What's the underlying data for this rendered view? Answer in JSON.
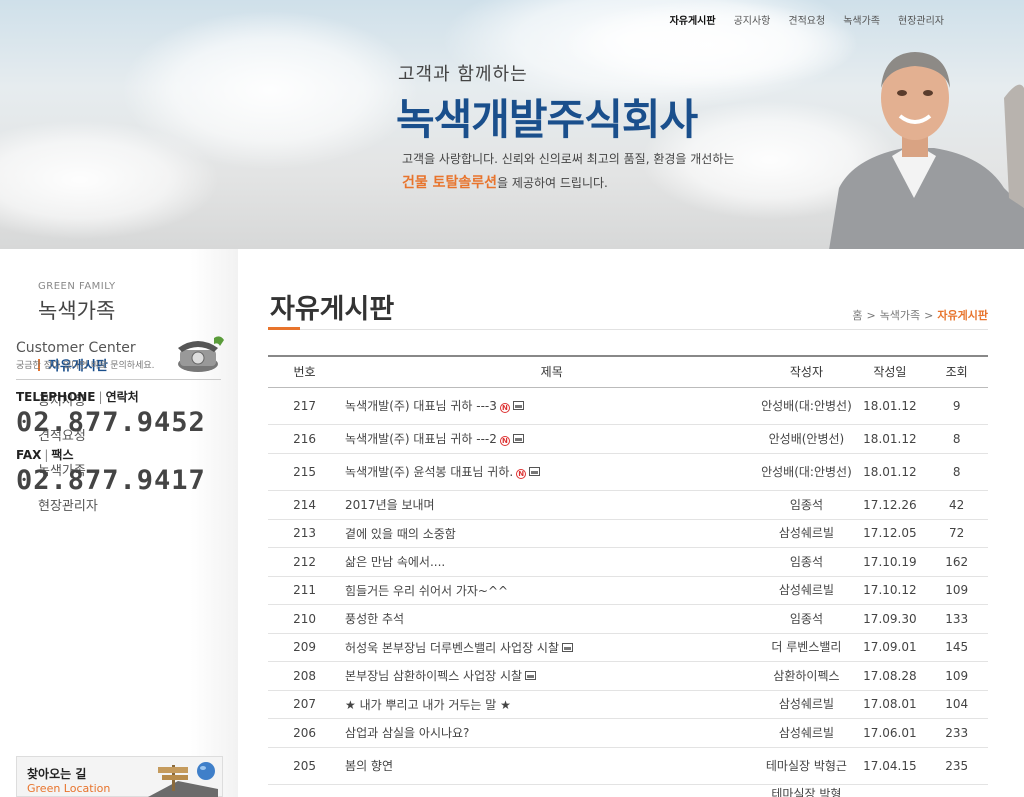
{
  "topnav": [
    "자유게시판",
    "공지사항",
    "견적요청",
    "녹색가족",
    "현장관리자"
  ],
  "hero": {
    "subtitle": "고객과 함께하는",
    "title": "녹색개발주식회사",
    "desc1": "고객을 사랑합니다. 신뢰와 신의로써 최고의 품질, 환경을 개선하는",
    "desc2_highlight": "건물 토탈솔루션",
    "desc2_rest": "을 제공하여 드립니다."
  },
  "sidebar": {
    "eng_title": "GREEN FAMILY",
    "title": "녹색가족",
    "menu": [
      "자유게시판",
      "공지사항",
      "견적요청",
      "녹색가족",
      "현장관리자"
    ],
    "customer_center": {
      "title": "Customer Center",
      "sub": "궁금한 점이 있다면 바로 문의하세요.",
      "tel_label": "TELEPHONE",
      "tel_label_kr": "연락처",
      "tel": "02.877.9452",
      "fax_label": "FAX",
      "fax_label_kr": "팩스",
      "fax": "02.877.9417"
    },
    "map": {
      "title": "찾아오는 길",
      "sub": "Green Location"
    }
  },
  "main": {
    "page_title": "자유게시판",
    "breadcrumb": [
      "홈",
      "녹색가족",
      "자유게시판"
    ],
    "columns": [
      "번호",
      "제목",
      "작성자",
      "작성일",
      "조회"
    ],
    "rows": [
      {
        "no": "217",
        "title": "녹색개발(주) 대표님 귀하 ---3",
        "new": true,
        "img": true,
        "writer": "안성배(대:안병선)",
        "date": "18.01.12",
        "views": "9"
      },
      {
        "no": "216",
        "title": "녹색개발(주) 대표님 귀하 ---2",
        "new": true,
        "img": true,
        "writer": "안성배(안병선)",
        "date": "18.01.12",
        "views": "8"
      },
      {
        "no": "215",
        "title": "녹색개발(주) 윤석봉 대표님 귀하.",
        "new": true,
        "img": true,
        "writer": "안성배(대:안병선)",
        "date": "18.01.12",
        "views": "8"
      },
      {
        "no": "214",
        "title": "2017년을 보내며",
        "new": false,
        "img": false,
        "writer": "임종석",
        "date": "17.12.26",
        "views": "42"
      },
      {
        "no": "213",
        "title": "곁에 있을 때의 소중함",
        "new": false,
        "img": false,
        "writer": "삼성쉐르빌",
        "date": "17.12.05",
        "views": "72"
      },
      {
        "no": "212",
        "title": "삶은 만남 속에서....",
        "new": false,
        "img": false,
        "writer": "임종석",
        "date": "17.10.19",
        "views": "162"
      },
      {
        "no": "211",
        "title": "힘들거든 우리 쉬어서 가자~^^",
        "new": false,
        "img": false,
        "writer": "삼성쉐르빌",
        "date": "17.10.12",
        "views": "109"
      },
      {
        "no": "210",
        "title": "풍성한 추석",
        "new": false,
        "img": false,
        "writer": "임종석",
        "date": "17.09.30",
        "views": "133"
      },
      {
        "no": "209",
        "title": "허성욱 본부장님 더루벤스밸리 사업장 시찰",
        "new": false,
        "img": true,
        "writer": "더 루벤스밸리",
        "date": "17.09.01",
        "views": "145"
      },
      {
        "no": "208",
        "title": "본부장님 삼환하이펙스 사업장 시찰",
        "new": false,
        "img": true,
        "writer": "삼환하이펙스",
        "date": "17.08.28",
        "views": "109"
      },
      {
        "no": "207",
        "title": "★ 내가 뿌리고 내가 거두는 말 ★",
        "new": false,
        "img": false,
        "writer": "삼성쉐르빌",
        "date": "17.08.01",
        "views": "104"
      },
      {
        "no": "206",
        "title": "삼업과 삼실을 아시나요?",
        "new": false,
        "img": false,
        "writer": "삼성쉐르빌",
        "date": "17.06.01",
        "views": "233"
      },
      {
        "no": "205",
        "title": "봄의 향연",
        "new": false,
        "img": false,
        "writer": "테마실장 박형근",
        "date": "17.04.15",
        "views": "235"
      },
      {
        "no": "",
        "title": "",
        "new": false,
        "img": false,
        "writer": "테마실장 박형",
        "date": "",
        "views": ""
      }
    ]
  },
  "colors": {
    "accent": "#e8742c",
    "brand": "#1a4f8c"
  }
}
